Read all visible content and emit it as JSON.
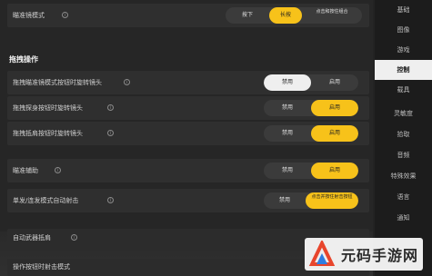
{
  "rows": [
    {
      "label": "瞄准镜模式",
      "options": [
        "按下",
        "长按",
        "点击和按住组合"
      ],
      "selected": 1
    },
    {
      "label": "拖拽瞄准镜模式按钮时旋转镜头",
      "options": [
        "禁用",
        "启用"
      ],
      "selected": 0
    },
    {
      "label": "拖拽探身按钮时旋转镜头",
      "options": [
        "禁用",
        "启用"
      ],
      "selected": 1
    },
    {
      "label": "拖拽抵肩按钮时旋转镜头",
      "options": [
        "禁用",
        "启用"
      ],
      "selected": 1
    },
    {
      "label": "瞄准辅助",
      "options": [
        "禁用",
        "启用"
      ],
      "selected": 1
    },
    {
      "label": "单发/连发模式自动射击",
      "options": [
        "禁用",
        "点击并按住射击按钮"
      ],
      "selected": 1
    },
    {
      "label": "自动武器抵肩",
      "options": [],
      "selected": -1
    },
    {
      "label": "操作按钮时射击模式",
      "options": [],
      "selected": -1
    }
  ],
  "section_title": "拖拽操作",
  "sidebar": [
    "基础",
    "图像",
    "游戏",
    "控制",
    "载具",
    "灵敏度",
    "拾取",
    "音频",
    "特殊效果",
    "语言",
    "通知"
  ],
  "sidebar_active": 3,
  "watermark_text": "元码手游网",
  "colors": {
    "accent": "#f7c21a",
    "background": "#262626",
    "sidebar": "#1c1c1c"
  }
}
